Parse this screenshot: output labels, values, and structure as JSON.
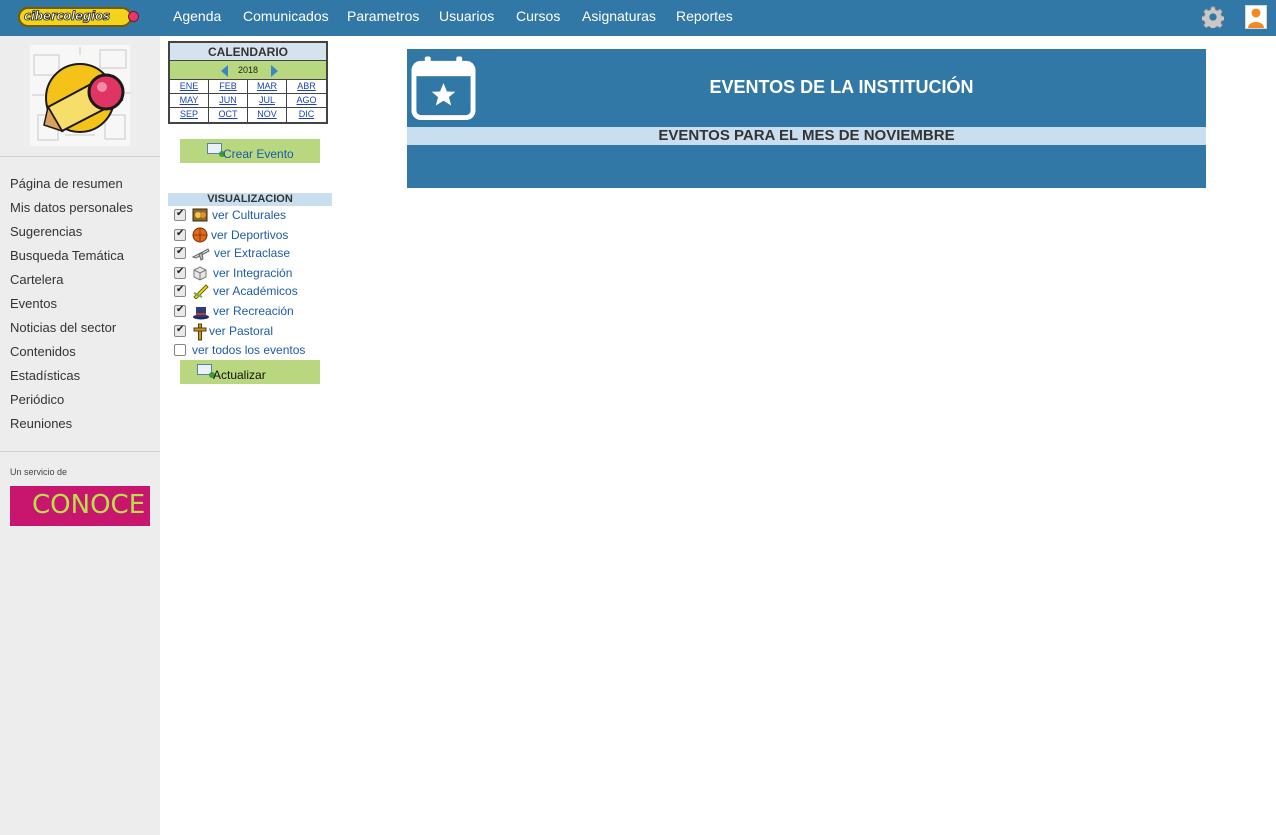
{
  "app": {
    "logo_text": "cibercolegios"
  },
  "nav": {
    "items": [
      {
        "label": "Agenda"
      },
      {
        "label": "Comunicados"
      },
      {
        "label": "Parametros"
      },
      {
        "label": "Usuarios"
      },
      {
        "label": "Cursos"
      },
      {
        "label": "Asignaturas"
      },
      {
        "label": "Reportes"
      }
    ],
    "icons": [
      "gear-icon",
      "user-avatar-icon"
    ]
  },
  "sidebar": {
    "items": [
      {
        "label": "Página de resumen"
      },
      {
        "label": "Mis datos personales"
      },
      {
        "label": "Sugerencias"
      },
      {
        "label": "Busqueda Temática"
      },
      {
        "label": "Cartelera"
      },
      {
        "label": "Eventos"
      },
      {
        "label": "Noticias del sector"
      },
      {
        "label": "Contenidos"
      },
      {
        "label": "Estadísticas"
      },
      {
        "label": "Periódico"
      },
      {
        "label": "Reuniones"
      }
    ],
    "service_label": "Un servicio de",
    "banner_text": "CONOCE"
  },
  "calendar": {
    "title": "CALENDARIO",
    "year": "2018",
    "months": [
      "ENE",
      "FEB",
      "MAR",
      "ABR",
      "MAY",
      "JUN",
      "JUL",
      "AGO",
      "SEP",
      "OCT",
      "NOV",
      "DIC"
    ]
  },
  "create_event": {
    "label": "Crear Evento"
  },
  "visualization": {
    "title": "VISUALIZACION",
    "options": [
      {
        "label": "ver Culturales",
        "checked": true,
        "icon": "culture-icon"
      },
      {
        "label": "ver Deportivos",
        "checked": true,
        "icon": "basketball-icon"
      },
      {
        "label": "ver Extraclase",
        "checked": true,
        "icon": "airplane-icon"
      },
      {
        "label": "ver Integración",
        "checked": true,
        "icon": "box-icon"
      },
      {
        "label": "ver Académicos",
        "checked": true,
        "icon": "pencil-icon"
      },
      {
        "label": "ver Recreación",
        "checked": true,
        "icon": "magic-hat-icon"
      },
      {
        "label": "ver Pastoral",
        "checked": true,
        "icon": "cross-icon"
      },
      {
        "label": "ver todos los eventos",
        "checked": false,
        "icon": ""
      }
    ],
    "update_label": "Actualizar"
  },
  "events": {
    "title": "EVENTOS DE LA INSTITUCIÓN",
    "month_heading": "EVENTOS PARA EL MES DE NOVIEMBRE"
  },
  "colors": {
    "brand_blue": "#3278a6",
    "green_button": "#b8d77e",
    "light_blue_strip": "#c9dff0"
  }
}
